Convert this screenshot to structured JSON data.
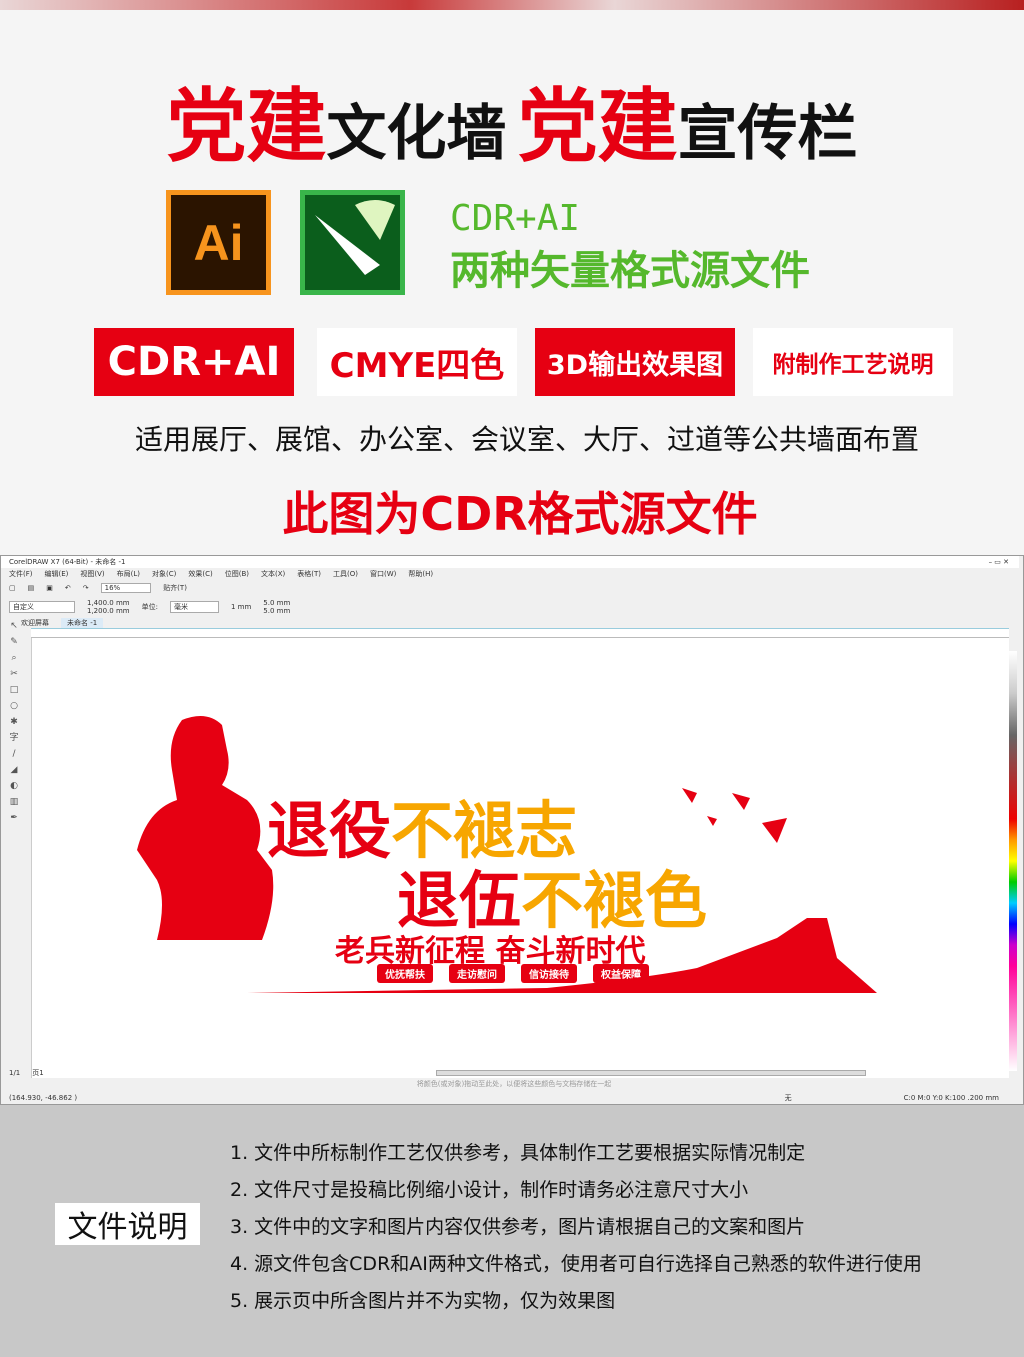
{
  "headline": {
    "part1": "党建",
    "part2": "文化墙",
    "part3": "党建",
    "part4": "宣传栏"
  },
  "logos": {
    "ai_label": "Ai",
    "cdr_icon": "coreldraw-logo"
  },
  "formats": {
    "line1": "CDR+AI",
    "line2": "两种矢量格式源文件"
  },
  "tags": [
    "CDR+AI",
    "CMYE四色",
    "3D输出效果图",
    "附制作工艺说明"
  ],
  "usage": "适用展厅、展馆、办公室、会议室、大厅、过道等公共墙面布置",
  "note": "此图为CDR格式源文件",
  "corel": {
    "title": "CorelDRAW X7 (64-Bit) - 未命名 -1",
    "menu": [
      "文件(F)",
      "编辑(E)",
      "视图(V)",
      "布局(L)",
      "对象(C)",
      "效果(C)",
      "位图(B)",
      "文本(X)",
      "表格(T)",
      "工具(O)",
      "窗口(W)",
      "帮助(H)"
    ],
    "zoom": "16%",
    "snap": "贴齐(T)",
    "preset": "自定义",
    "width": "1,400.0 mm",
    "height": "1,200.0 mm",
    "unit_label": "单位:",
    "unit": "毫米",
    "nudge": "1 mm",
    "dup_x": "5.0 mm",
    "dup_y": "5.0 mm",
    "tabs": [
      "欢迎屏幕",
      "未命名 -1"
    ],
    "page_nav": "1/1",
    "page_tab": "页1",
    "hint": "将颜色(或对象)拖动至此处，以便将这些颜色与文档存储在一起",
    "coords": "(164.930, -46.862 )",
    "fill_none": "无",
    "outline": "C:0 M:0 Y:0 K:100  .200 mm",
    "design": {
      "l1a": "退役",
      "l1b": "不褪志",
      "l2a": "退伍",
      "l2b": "不褪色",
      "l3": "老兵新征程 奋斗新时代",
      "pills": [
        "优抚帮扶",
        "走访慰问",
        "信访接待",
        "权益保障"
      ]
    },
    "colors": {
      "red": "#e60012",
      "yellow": "#f7a600"
    }
  },
  "file_notes": {
    "label": "文件说明",
    "items": [
      "1. 文件中所标制作工艺仅供参考，具体制作工艺要根据实际情况制定",
      "2. 文件尺寸是投稿比例缩小设计，制作时请务必注意尺寸大小",
      "3. 文件中的文字和图片内容仅供参考，图片请根据自己的文案和图片",
      "4. 源文件包含CDR和AI两种文件格式，使用者可自行选择自己熟悉的软件进行使用",
      "5. 展示页中所含图片并不为实物，仅为效果图"
    ]
  }
}
